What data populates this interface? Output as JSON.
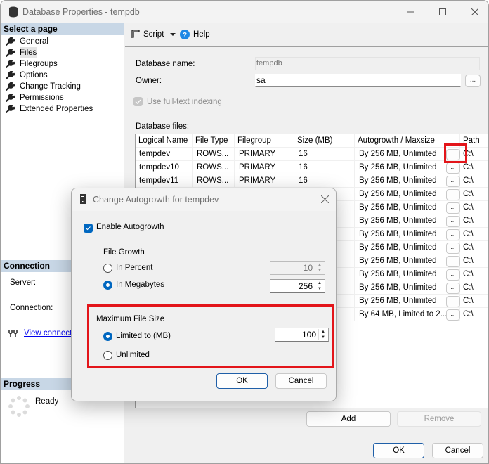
{
  "window": {
    "title": "Database Properties - tempdb",
    "controls": [
      "minimize",
      "maximize",
      "close"
    ]
  },
  "sidebar": {
    "select_page_header": "Select a page",
    "items": [
      {
        "label": "General",
        "icon": "wrench-icon",
        "selected": false
      },
      {
        "label": "Files",
        "icon": "wrench-icon",
        "selected": true
      },
      {
        "label": "Filegroups",
        "icon": "wrench-icon",
        "selected": false
      },
      {
        "label": "Options",
        "icon": "wrench-icon",
        "selected": false
      },
      {
        "label": "Change Tracking",
        "icon": "wrench-icon",
        "selected": false
      },
      {
        "label": "Permissions",
        "icon": "wrench-icon",
        "selected": false
      },
      {
        "label": "Extended Properties",
        "icon": "wrench-icon",
        "selected": false
      }
    ],
    "connection_header": "Connection",
    "server_label": "Server:",
    "connection_label": "Connection:",
    "view_connection_link": "View connection properties",
    "progress_header": "Progress",
    "progress_status": "Ready"
  },
  "toolbar": {
    "script_label": "Script",
    "help_label": "Help"
  },
  "form": {
    "database_name_label": "Database name:",
    "database_name_value": "tempdb",
    "owner_label": "Owner:",
    "owner_value": "sa",
    "owner_browse": "...",
    "fulltext_label": "Use full-text indexing",
    "fulltext_checked": true,
    "fulltext_enabled": false,
    "database_files_label": "Database files:"
  },
  "files_table": {
    "columns": [
      "Logical Name",
      "File Type",
      "Filegroup",
      "Size (MB)",
      "Autogrowth / Maxsize",
      "",
      "Path"
    ],
    "rows": [
      {
        "name": "tempdev",
        "type": "ROWS...",
        "filegroup": "PRIMARY",
        "size": "16",
        "autogrowth": "By 256 MB, Unlimited",
        "btn": "...",
        "path": "C:\\"
      },
      {
        "name": "tempdev10",
        "type": "ROWS...",
        "filegroup": "PRIMARY",
        "size": "16",
        "autogrowth": "By 256 MB, Unlimited",
        "btn": "...",
        "path": "C:\\"
      },
      {
        "name": "tempdev11",
        "type": "ROWS...",
        "filegroup": "PRIMARY",
        "size": "16",
        "autogrowth": "By 256 MB, Unlimited",
        "btn": "...",
        "path": "C:\\"
      },
      {
        "name": "",
        "type": "",
        "filegroup": "",
        "size": "",
        "autogrowth": "By 256 MB, Unlimited",
        "btn": "...",
        "path": "C:\\"
      },
      {
        "name": "",
        "type": "",
        "filegroup": "",
        "size": "",
        "autogrowth": "By 256 MB, Unlimited",
        "btn": "...",
        "path": "C:\\"
      },
      {
        "name": "",
        "type": "",
        "filegroup": "",
        "size": "",
        "autogrowth": "By 256 MB, Unlimited",
        "btn": "...",
        "path": "C:\\"
      },
      {
        "name": "",
        "type": "",
        "filegroup": "",
        "size": "",
        "autogrowth": "By 256 MB, Unlimited",
        "btn": "...",
        "path": "C:\\"
      },
      {
        "name": "",
        "type": "",
        "filegroup": "",
        "size": "",
        "autogrowth": "By 256 MB, Unlimited",
        "btn": "...",
        "path": "C:\\"
      },
      {
        "name": "",
        "type": "",
        "filegroup": "",
        "size": "",
        "autogrowth": "By 256 MB, Unlimited",
        "btn": "...",
        "path": "C:\\"
      },
      {
        "name": "",
        "type": "",
        "filegroup": "",
        "size": "",
        "autogrowth": "By 256 MB, Unlimited",
        "btn": "...",
        "path": "C:\\"
      },
      {
        "name": "",
        "type": "",
        "filegroup": "",
        "size": "",
        "autogrowth": "By 256 MB, Unlimited",
        "btn": "...",
        "path": "C:\\"
      },
      {
        "name": "",
        "type": "",
        "filegroup": "",
        "size": "",
        "autogrowth": "By 256 MB, Unlimited",
        "btn": "...",
        "path": "C:\\"
      },
      {
        "name": "",
        "type": "",
        "filegroup": "",
        "size": "",
        "autogrowth": "By 64 MB, Limited to 2...",
        "btn": "...",
        "path": "C:\\"
      }
    ],
    "add_label": "Add",
    "remove_label": "Remove"
  },
  "footer": {
    "ok_label": "OK",
    "cancel_label": "Cancel"
  },
  "autogrowth_dialog": {
    "title": "Change Autogrowth for tempdev",
    "enable_label": "Enable Autogrowth",
    "enable_checked": true,
    "file_growth_label": "File Growth",
    "in_percent_label": "In Percent",
    "in_percent_value": "10",
    "in_megabytes_label": "In Megabytes",
    "in_megabytes_value": "256",
    "file_growth_selected": "In Megabytes",
    "max_size_label": "Maximum File Size",
    "limited_label": "Limited to (MB)",
    "limited_value": "100",
    "unlimited_label": "Unlimited",
    "max_size_selected": "Limited to (MB)",
    "ok_label": "OK",
    "cancel_label": "Cancel"
  },
  "highlight_color": "#e3151a",
  "accent_color": "#0067c0"
}
